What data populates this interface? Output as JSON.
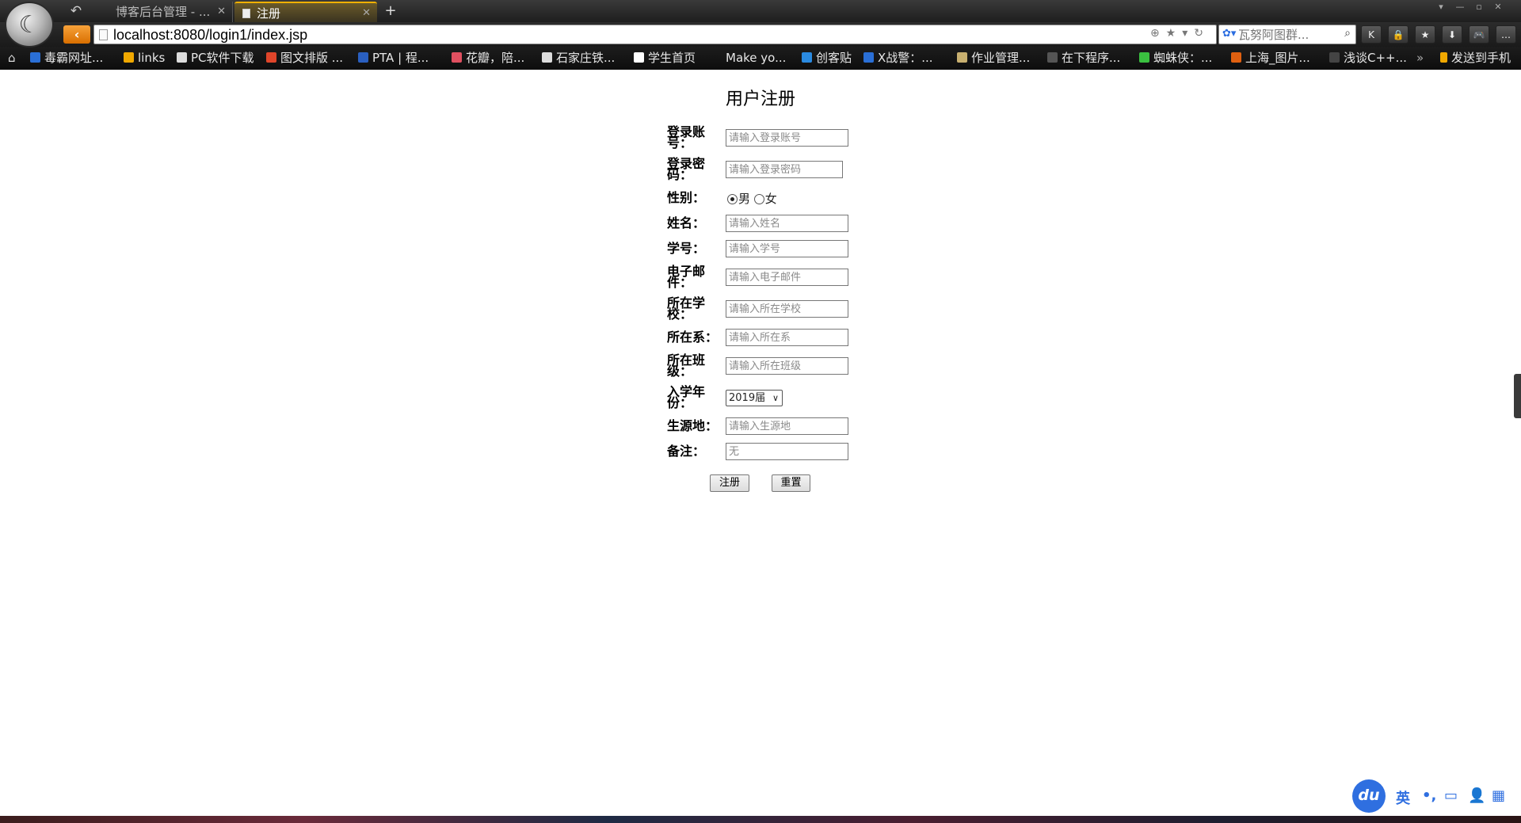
{
  "browser": {
    "tabs": [
      {
        "label": "博客后台管理 - ...",
        "active": false
      },
      {
        "label": "注册",
        "active": true
      }
    ],
    "new_tab_symbol": "+",
    "url": "localhost:8080/login1/index.jsp",
    "search_placeholder": "瓦努阿图群...",
    "toolbar_buttons": [
      "K",
      "🔒",
      "★",
      "⬇",
      "🎮",
      "…"
    ]
  },
  "bookmarks": [
    {
      "label": "毒霸网址...",
      "icon_color": "#2a6fd6"
    },
    {
      "label": "links",
      "icon_color": "#f0a800"
    },
    {
      "label": "PC软件下载",
      "icon_color": "#dddddd"
    },
    {
      "label": "图文排版 ...",
      "icon_color": "#e0452a"
    },
    {
      "label": "PTA | 程...",
      "icon_color": "#2a5fc0"
    },
    {
      "label": "花瓣，陪...",
      "icon_color": "#e05060"
    },
    {
      "label": "石家庄铁...",
      "icon_color": "#dddddd"
    },
    {
      "label": "学生首页",
      "icon_color": "#ffffff"
    },
    {
      "label": "Make yo...",
      "icon_color": ""
    },
    {
      "label": "创客贴",
      "icon_color": "#2a8ae0"
    },
    {
      "label": "X战警：...",
      "icon_color": "#2a6fd6"
    },
    {
      "label": "作业管理...",
      "icon_color": "#c8b070"
    },
    {
      "label": "在下程序...",
      "icon_color": "#555555"
    },
    {
      "label": "蜘蛛侠：...",
      "icon_color": "#3ac040"
    },
    {
      "label": "上海_图片...",
      "icon_color": "#e06010"
    },
    {
      "label": "浅谈C++...",
      "icon_color": "#444444"
    }
  ],
  "bookmarks_overflow": "»",
  "send_to_phone": "发送到手机",
  "form": {
    "title": "用户注册",
    "fields": {
      "account": {
        "label": "登录账号：",
        "placeholder": "请输入登录账号"
      },
      "password": {
        "label": "登录密码：",
        "placeholder": "请输入登录密码"
      },
      "gender": {
        "label": "性别：",
        "options": [
          "男",
          "女"
        ],
        "selected": "男"
      },
      "name": {
        "label": "姓名：",
        "placeholder": "请输入姓名"
      },
      "student_id": {
        "label": "学号：",
        "placeholder": "请输入学号"
      },
      "email": {
        "label": "电子邮件：",
        "placeholder": "请输入电子邮件"
      },
      "school": {
        "label": "所在学校：",
        "placeholder": "请输入所在学校"
      },
      "department": {
        "label": "所在系：",
        "placeholder": "请输入所在系"
      },
      "class": {
        "label": "所在班级：",
        "placeholder": "请输入所在班级"
      },
      "year": {
        "label": "入学年份：",
        "value": "2019届"
      },
      "origin": {
        "label": "生源地：",
        "placeholder": "请输入生源地"
      },
      "note": {
        "label": "备注：",
        "placeholder": "无"
      }
    },
    "submit_label": "注册",
    "reset_label": "重置"
  },
  "ime": {
    "logo": "du",
    "lang": "英",
    "items": [
      "•,",
      "▭",
      "👤",
      "▦"
    ]
  }
}
